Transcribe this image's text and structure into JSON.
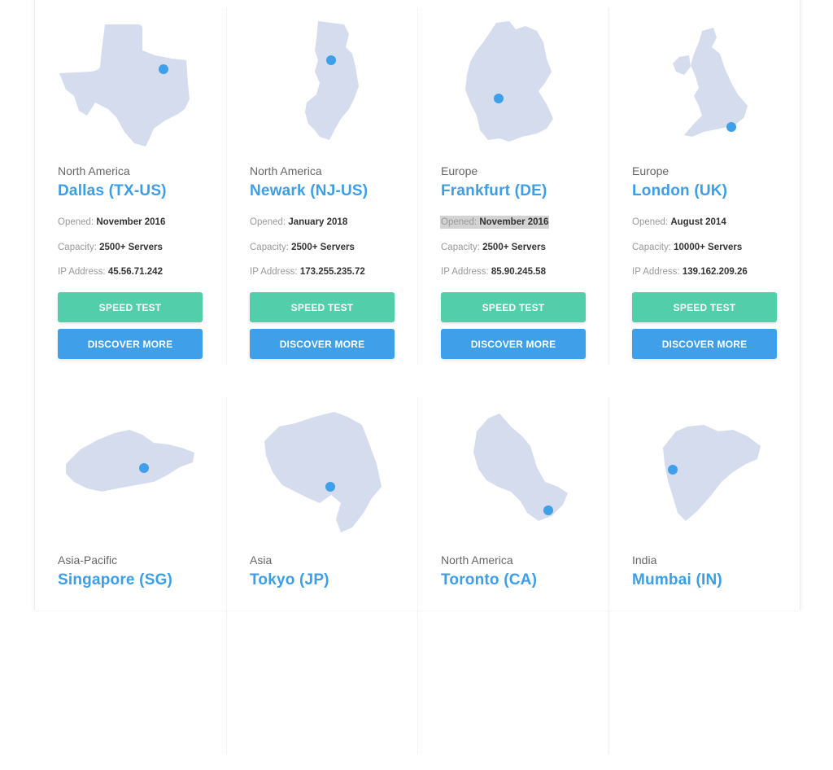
{
  "colors": {
    "accent_blue": "#3f9fe8",
    "speed_green": "#52cfaa",
    "map_fill": "#d5dcee"
  },
  "labels": {
    "opened": "Opened:",
    "capacity": "Capacity:",
    "ip": "IP Address:"
  },
  "buttons": {
    "speed_test": "SPEED TEST",
    "discover_more": "DISCOVER MORE"
  },
  "locations": [
    {
      "region": "North America",
      "city": "Dallas (TX-US)",
      "map_icon": "texas-map-icon",
      "opened": "November 2016",
      "capacity": "2500+ Servers",
      "ip": "45.56.71.242"
    },
    {
      "region": "North America",
      "city": "Newark (NJ-US)",
      "map_icon": "new-jersey-map-icon",
      "opened": "January 2018",
      "capacity": "2500+ Servers",
      "ip": "173.255.235.72"
    },
    {
      "region": "Europe",
      "city": "Frankfurt (DE)",
      "map_icon": "germany-map-icon",
      "opened": "November 2016",
      "capacity": "2500+ Servers",
      "ip": "85.90.245.58"
    },
    {
      "region": "Europe",
      "city": "London (UK)",
      "map_icon": "uk-map-icon",
      "opened": "August 2014",
      "capacity": "10000+ Servers",
      "ip": "139.162.209.26"
    },
    {
      "region": "Asia-Pacific",
      "city": "Singapore (SG)",
      "map_icon": "singapore-map-icon"
    },
    {
      "region": "Asia",
      "city": "Tokyo (JP)",
      "map_icon": "tokyo-map-icon"
    },
    {
      "region": "North America",
      "city": "Toronto (CA)",
      "map_icon": "ontario-map-icon"
    },
    {
      "region": "India",
      "city": "Mumbai (IN)",
      "map_icon": "maharashtra-map-icon"
    }
  ]
}
